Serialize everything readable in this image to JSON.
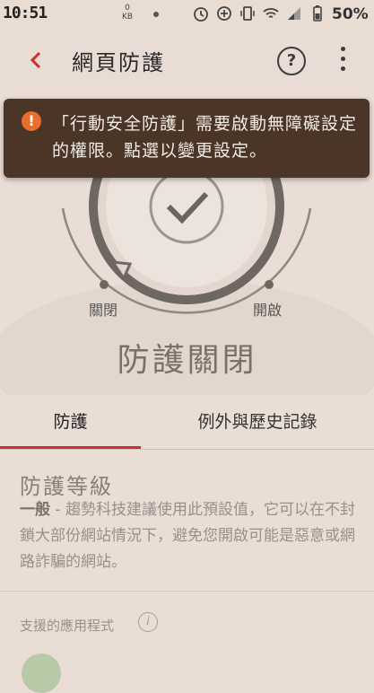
{
  "statusbar": {
    "clock": "10:51",
    "net_rate": "0",
    "net_unit": "KB",
    "battery": "50%"
  },
  "appbar": {
    "title": "網頁防護",
    "help_label": "?"
  },
  "banner": {
    "message": "「行動安全防護」需要啟動無障礙設定的權限。點選以變更設定。"
  },
  "hero": {
    "left_label": "關閉",
    "right_label": "開啟",
    "status": "防護關閉"
  },
  "tabs": [
    {
      "label": "防護"
    },
    {
      "label": "例外與歷史記錄"
    }
  ],
  "content": {
    "level_title": "防護等級",
    "level_name": "一般",
    "level_desc": " - 趨勢科技建議使用此預設值，它可以在不封鎖大部份網站情況下，避免您開啟可能是惡意或網路詐騙的網站。",
    "apps_label": "支援的應用程式"
  },
  "colors": {
    "accent": "#c9302c",
    "banner_bg": "#4a3527",
    "warn": "#e76f2b",
    "background": "#e9ddd6"
  }
}
